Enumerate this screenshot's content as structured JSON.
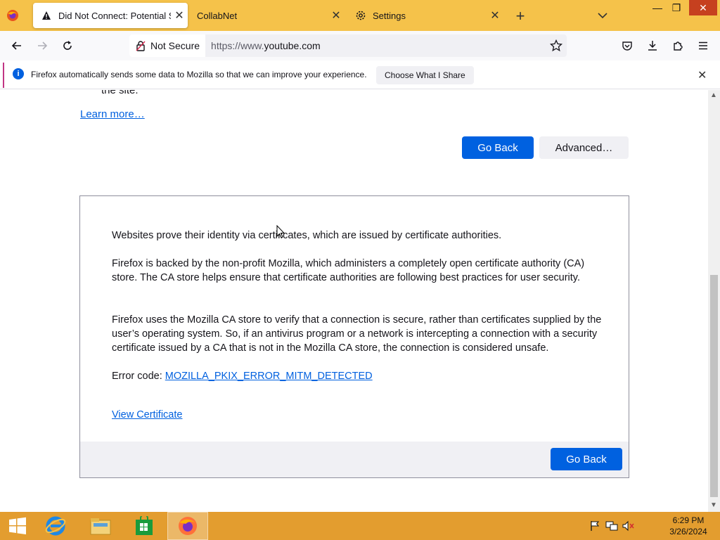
{
  "browser": {
    "tabs": [
      {
        "label": "Did Not Connect: Potential Security Issue",
        "icon": "warning-icon",
        "active": true
      },
      {
        "label": "CollabNet",
        "icon": "",
        "active": false
      },
      {
        "label": "Settings",
        "icon": "gear-icon",
        "active": false
      }
    ],
    "new_tab": "+",
    "window_controls": {
      "minimize": "—",
      "restore": "❐",
      "close": "✕"
    }
  },
  "navbar": {
    "security_label": "Not Secure",
    "url_prefix": "https://www.",
    "url_domain": "youtube.com"
  },
  "notification": {
    "message": "Firefox automatically sends some data to Mozilla so that we can improve your experience.",
    "button": "Choose What I Share",
    "close": "✕"
  },
  "page": {
    "cut_text": "the site.",
    "learn_more": "Learn more…",
    "go_back": "Go Back",
    "advanced": "Advanced…",
    "panel": {
      "p1": "Websites prove their identity via certificates, which are issued by certificate authorities.",
      "p2": "Firefox is backed by the non-profit Mozilla, which administers a completely open certificate authority (CA) store. The CA store helps ensure that certificate authorities are following best practices for user security.",
      "p3": "Firefox uses the Mozilla CA store to verify that a connection is secure, rather than certificates supplied by the user’s operating system. So, if an antivirus program or a network is intercepting a connection with a security certificate issued by a CA that is not in the Mozilla CA store, the connection is considered unsafe.",
      "error_label": "Error code: ",
      "error_code": "MOZILLA_PKIX_ERROR_MITM_DETECTED",
      "view_certificate": "View Certificate",
      "go_back": "Go Back"
    }
  },
  "taskbar": {
    "items": [
      "start-button",
      "internet-explorer",
      "file-explorer",
      "store",
      "firefox"
    ],
    "time": "6:29 PM",
    "date": "3/26/2024"
  },
  "colors": {
    "tabstrip": "#f5c24a",
    "taskbar": "#e39d2f",
    "primary_button": "#0061e0",
    "link": "#0060df"
  }
}
